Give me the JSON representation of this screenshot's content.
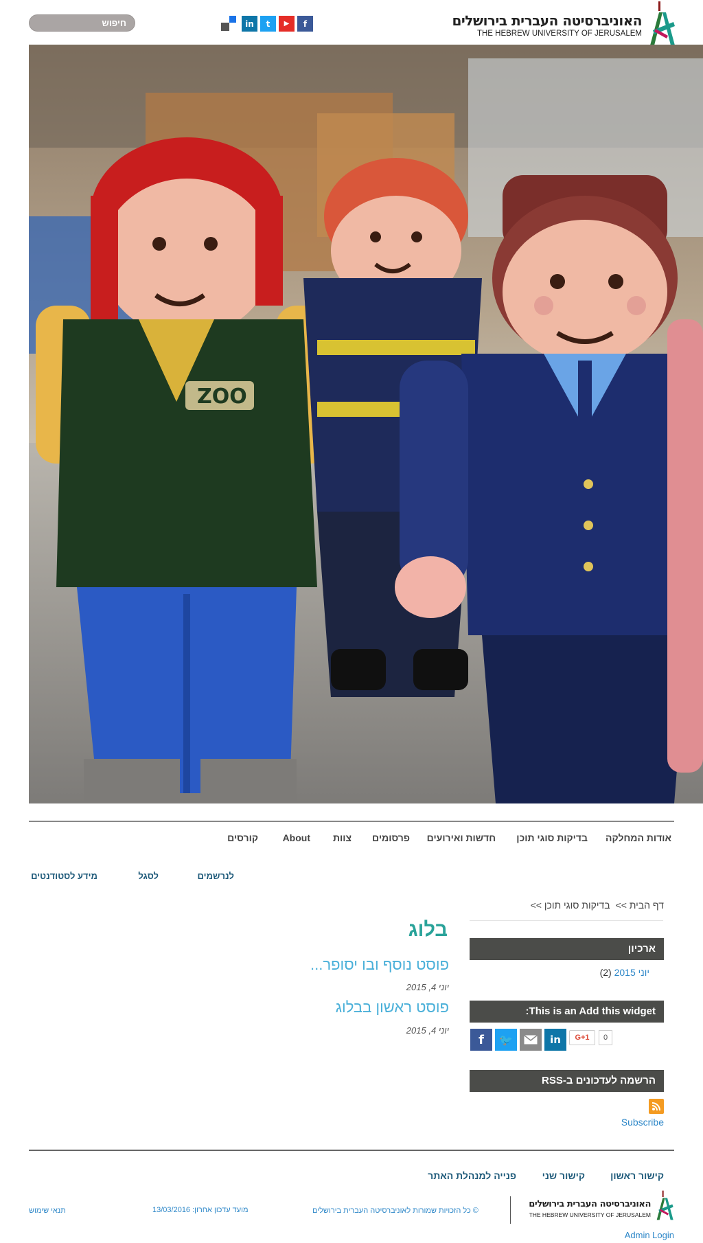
{
  "header": {
    "logo_hebrew": "האוניברסיטה העברית בירושלים",
    "logo_english": "THE HEBREW UNIVERSITY OF JERUSALEM",
    "social": [
      {
        "name": "addthis",
        "label": ""
      },
      {
        "name": "linkedin",
        "label": "in",
        "color": "#0e76a8"
      },
      {
        "name": "twitter",
        "label": "t",
        "color": "#1da1f2"
      },
      {
        "name": "youtube",
        "label": "▶",
        "color": "#e52d27"
      },
      {
        "name": "facebook",
        "label": "f",
        "color": "#3b5998"
      }
    ],
    "search_label": "חיפוש"
  },
  "nav": {
    "items": [
      "אודות המחלקה",
      "בדיקות סוגי תוכן",
      "חדשות ואירועים",
      "פרסומים",
      "צוות",
      "About",
      "קורסים"
    ],
    "sub_items": [
      "לנרשמים",
      "לסגל",
      "מידע לסטודנטים"
    ]
  },
  "breadcrumb": {
    "home": "דף הבית >>",
    "current": "בדיקות סוגי תוכן >>"
  },
  "sidebar": {
    "archive_title": "ארכיון",
    "archive_link": "יוני 2015",
    "archive_count": "(2)",
    "addthis_title": "This is an Add this widget:",
    "gplus_label": "G+1",
    "gplus_count": "0",
    "rss_title": "הרשמה לעדכונים ב-RSS",
    "rss_subscribe": "Subscribe"
  },
  "content": {
    "title": "בלוג",
    "posts": [
      {
        "title": "פוסט נוסף ובו יסופר...",
        "date": "יוני 4, 2015"
      },
      {
        "title": "פוסט ראשון בבלוג",
        "date": "יוני 4, 2015"
      }
    ]
  },
  "footer": {
    "links": [
      "קישור ראשון",
      "קישור שני",
      "פנייה למנהלת האתר"
    ],
    "logo_hebrew": "האוניברסיטה העברית בירושלים",
    "logo_english": "THE HEBREW UNIVERSITY OF JERUSALEM",
    "copyright": "© כל הזכויות שמורות לאוניברסיטה העברית בירושלים",
    "updated": "מועד עדכון אחרון: 13/03/2016",
    "terms": "תנאי שימוש",
    "admin": "Admin Login"
  },
  "colors": {
    "accent_teal": "#2aa39a",
    "link_blue": "#2d87c8",
    "sidebar_header": "#4b4c49",
    "rss_orange": "#f49b22"
  }
}
